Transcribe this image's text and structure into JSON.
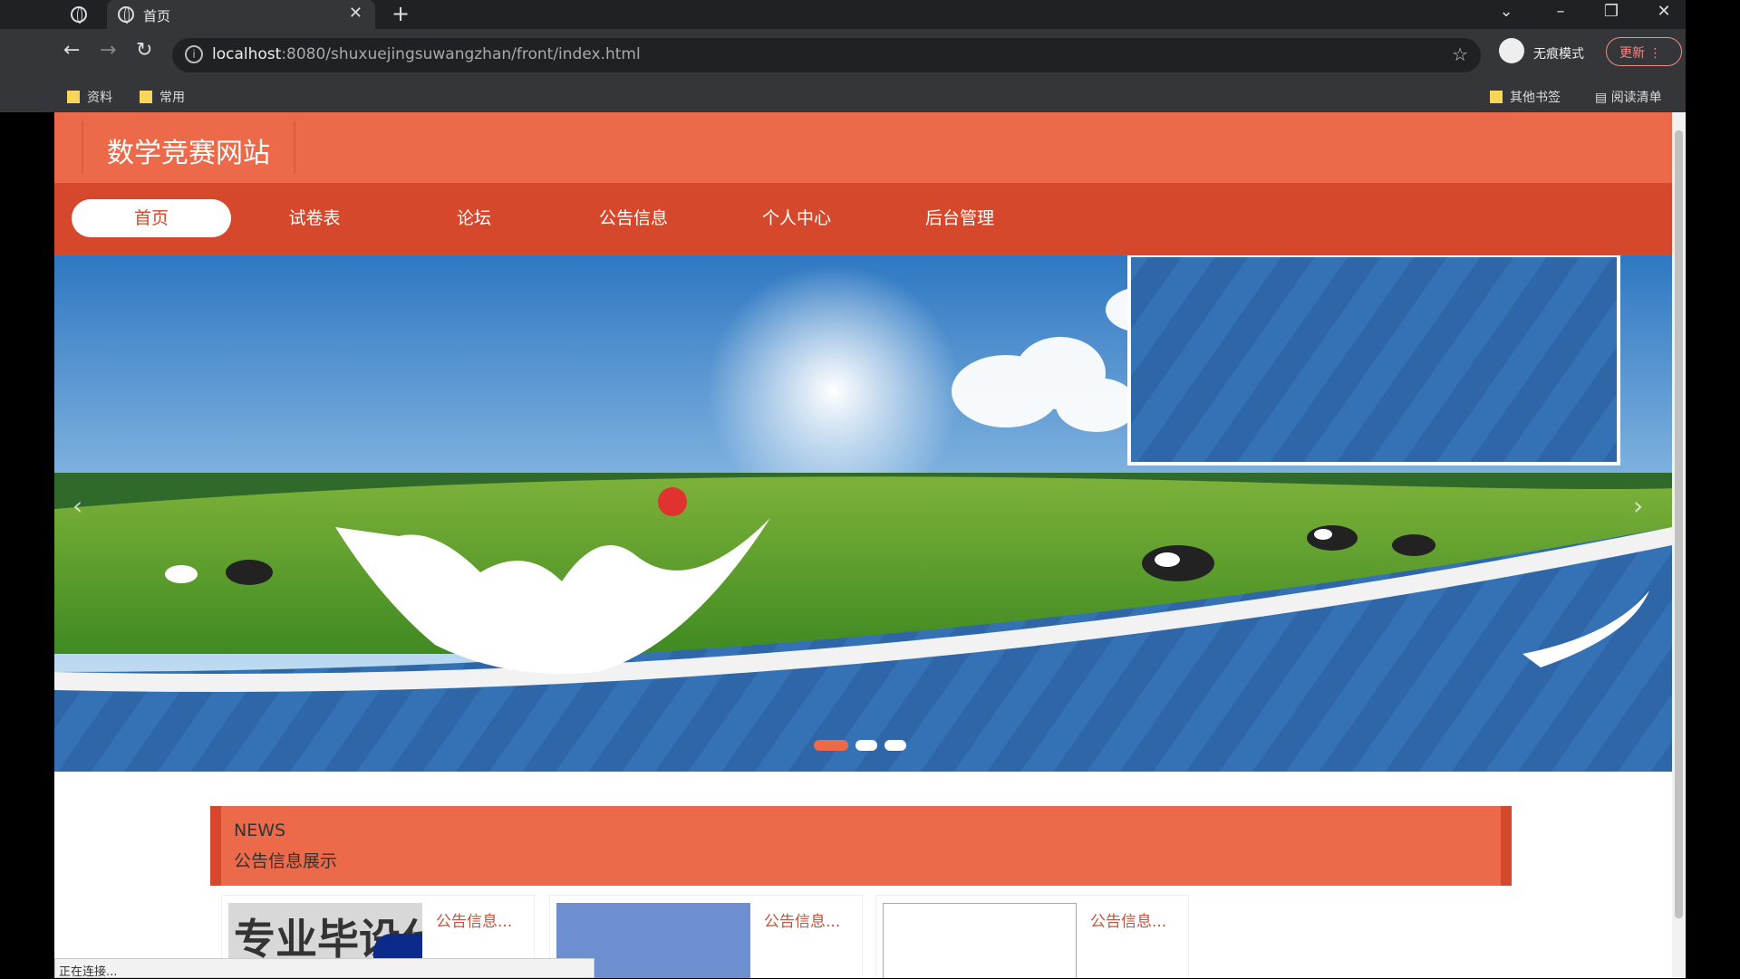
{
  "browser": {
    "tab_title": "首页",
    "url_host": "localhost",
    "url_path": ":8080/shuxuejingsuwangzhan/front/index.html",
    "incognito_label": "无痕模式",
    "update_label": "更新",
    "bookmarks": [
      "资料",
      "常用"
    ],
    "other_bookmarks": "其他书签",
    "reading_list": "阅读清单",
    "status_text": "正在连接..."
  },
  "site": {
    "title": "数学竞赛网站",
    "nav": [
      {
        "label": "首页",
        "active": true
      },
      {
        "label": "试卷表"
      },
      {
        "label": "论坛"
      },
      {
        "label": "公告信息"
      },
      {
        "label": "个人中心"
      },
      {
        "label": "后台管理"
      }
    ]
  },
  "carousel": {
    "slide_count": 3,
    "active_index": 0,
    "prev_icon": "chevron-left-icon",
    "next_icon": "chevron-right-icon"
  },
  "news": {
    "heading_en": "NEWS",
    "heading_cn": "公告信息展示",
    "cards": [
      {
        "title": "公告信息...",
        "image_text": "专业毕设代"
      },
      {
        "title": "公告信息..."
      },
      {
        "title": "公告信息..."
      }
    ]
  },
  "colors": {
    "header": "#ec6a4a",
    "nav": "#d5482b",
    "banner_blue": "#2e66a8"
  }
}
